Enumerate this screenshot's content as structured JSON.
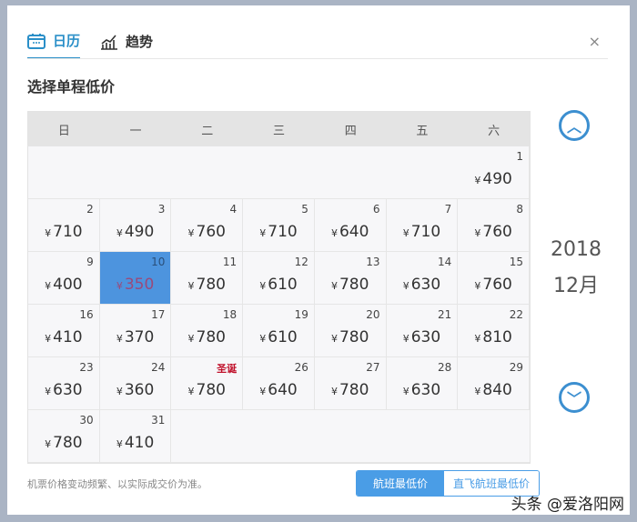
{
  "tabs": [
    {
      "label": "日历",
      "icon": "calendar-icon",
      "active": true
    },
    {
      "label": "趋势",
      "icon": "trend-chart-icon",
      "active": false
    }
  ],
  "close_label": "×",
  "title": "选择单程低价",
  "weekdays": [
    "日",
    "一",
    "二",
    "三",
    "四",
    "五",
    "六"
  ],
  "currency": "¥",
  "leading_empty": 6,
  "days": [
    {
      "d": "1",
      "p": "490"
    },
    {
      "d": "2",
      "p": "710"
    },
    {
      "d": "3",
      "p": "490"
    },
    {
      "d": "4",
      "p": "760"
    },
    {
      "d": "5",
      "p": "710"
    },
    {
      "d": "6",
      "p": "640"
    },
    {
      "d": "7",
      "p": "710"
    },
    {
      "d": "8",
      "p": "760"
    },
    {
      "d": "9",
      "p": "400"
    },
    {
      "d": "10",
      "p": "350",
      "selected": true
    },
    {
      "d": "11",
      "p": "780"
    },
    {
      "d": "12",
      "p": "610"
    },
    {
      "d": "13",
      "p": "780"
    },
    {
      "d": "14",
      "p": "630"
    },
    {
      "d": "15",
      "p": "760"
    },
    {
      "d": "16",
      "p": "410"
    },
    {
      "d": "17",
      "p": "370"
    },
    {
      "d": "18",
      "p": "780"
    },
    {
      "d": "19",
      "p": "610"
    },
    {
      "d": "20",
      "p": "780"
    },
    {
      "d": "21",
      "p": "630"
    },
    {
      "d": "22",
      "p": "810"
    },
    {
      "d": "23",
      "p": "630"
    },
    {
      "d": "24",
      "p": "360"
    },
    {
      "d": "圣诞",
      "p": "780",
      "holiday": true
    },
    {
      "d": "26",
      "p": "640"
    },
    {
      "d": "27",
      "p": "780"
    },
    {
      "d": "28",
      "p": "630"
    },
    {
      "d": "29",
      "p": "840"
    },
    {
      "d": "30",
      "p": "780"
    },
    {
      "d": "31",
      "p": "410"
    }
  ],
  "year": "2018",
  "month": "12月",
  "note": "机票价格变动频繁、以实际成交价为准。",
  "toggle": {
    "active": "航班最低价",
    "inactive": "直飞航班最低价"
  },
  "watermark": "头条 @爱洛阳网"
}
